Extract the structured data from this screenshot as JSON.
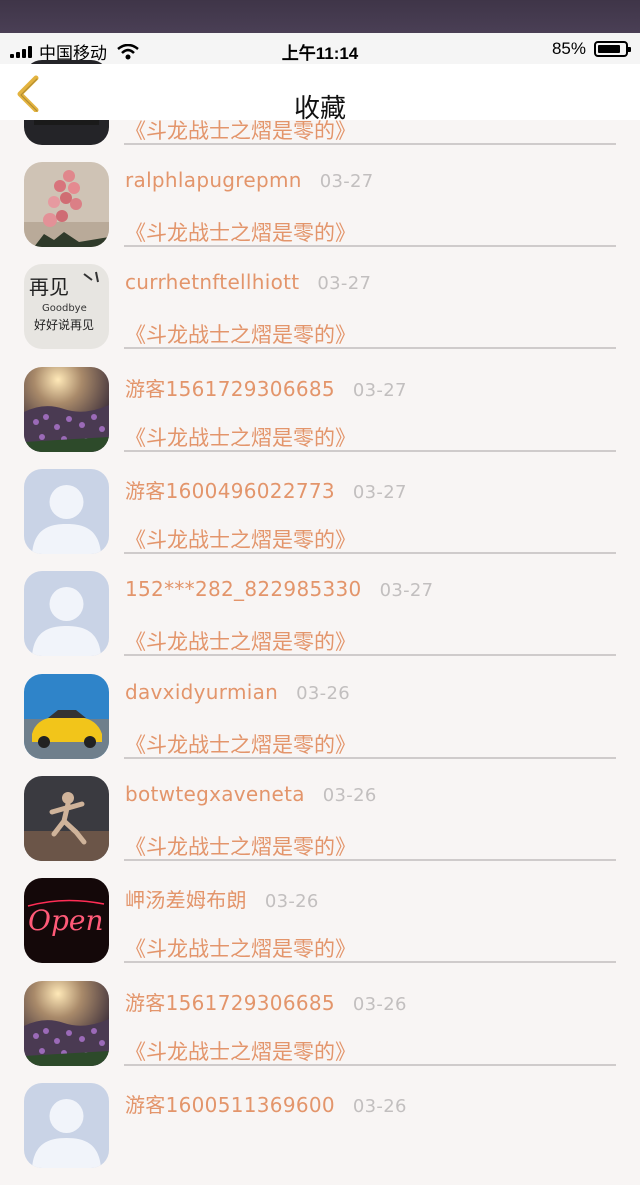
{
  "status_bar": {
    "carrier": "中国移动",
    "time": "上午11:14",
    "battery_text": "85%",
    "battery_level": 0.85
  },
  "nav": {
    "title": "收藏",
    "back_icon": "chevron-left-icon",
    "accent": "#e3b33f"
  },
  "colors": {
    "accent_text": "#e3956b",
    "date_text": "#c2bfbf",
    "divider": "#cfcbcb"
  },
  "list": {
    "items": [
      {
        "username": "",
        "date": "",
        "title": "《斗龙战士之熠是零的》",
        "avatar": "car-dark"
      },
      {
        "username": "ralphlapugrepmn",
        "date": "03-27",
        "title": "《斗龙战士之熠是零的》",
        "avatar": "balloons"
      },
      {
        "username": "currhetnftellhiott",
        "date": "03-27",
        "title": "《斗龙战士之熠是零的》",
        "avatar": "goodbye-sign"
      },
      {
        "username": "游客1561729306685",
        "date": "03-27",
        "title": "《斗龙战士之熠是零的》",
        "avatar": "flower-field"
      },
      {
        "username": "游客1600496022773",
        "date": "03-27",
        "title": "《斗龙战士之熠是零的》",
        "avatar": "default-person"
      },
      {
        "username": "152***282_822985330",
        "date": "03-27",
        "title": "《斗龙战士之熠是零的》",
        "avatar": "default-person"
      },
      {
        "username": "davxidyurmian",
        "date": "03-26",
        "title": "《斗龙战士之熠是零的》",
        "avatar": "yellow-car"
      },
      {
        "username": "botwtegxaveneta",
        "date": "03-26",
        "title": "《斗龙战士之熠是零的》",
        "avatar": "runner"
      },
      {
        "username": "岬汤差姆布朗",
        "date": "03-26",
        "title": "《斗龙战士之熠是零的》",
        "avatar": "open-neon"
      },
      {
        "username": "游客1561729306685",
        "date": "03-26",
        "title": "《斗龙战士之熠是零的》",
        "avatar": "flower-field"
      },
      {
        "username": "游客1600511369600",
        "date": "03-26",
        "title": "",
        "avatar": "default-person"
      }
    ]
  }
}
